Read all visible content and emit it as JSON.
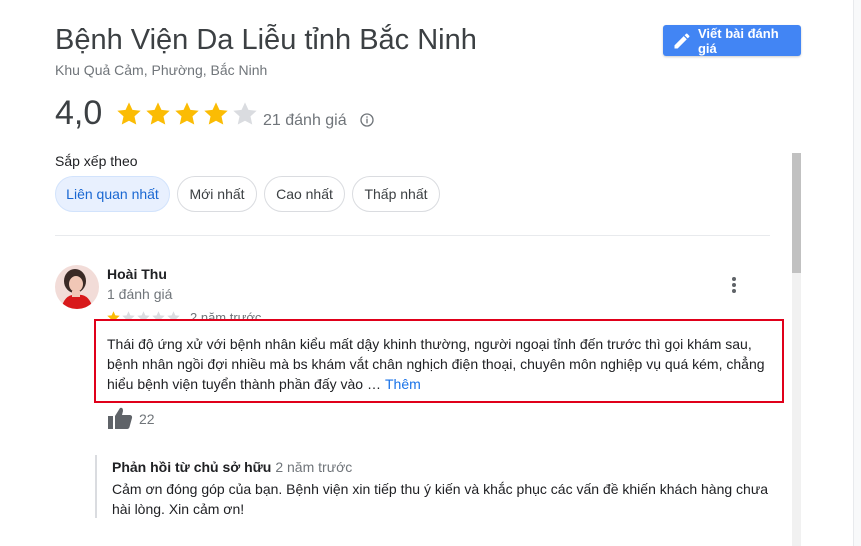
{
  "place": {
    "title": "Bệnh Viện Da Liễu tỉnh Bắc Ninh",
    "address": "Khu Quả Cảm, Phường, Bắc Ninh",
    "write_review_label": "Viết bài đánh giá"
  },
  "rating": {
    "value": "4,0",
    "stars": 4,
    "count_label": "21 đánh giá"
  },
  "sort": {
    "label": "Sắp xếp theo",
    "options": [
      "Liên quan nhất",
      "Mới nhất",
      "Cao nhất",
      "Thấp nhất"
    ],
    "selected": "Liên quan nhất"
  },
  "review": {
    "author": "Hoài Thu",
    "author_meta": "1 đánh giá",
    "stars": 1,
    "time": "2 năm trước",
    "text": "Thái độ ứng xử với bệnh nhân kiểu mất dậy khinh thường, người ngoại tỉnh đến trước thì gọi khám sau, bệnh nhân ngồi đợi nhiều mà bs khám vắt chân nghịch điện thoại, chuyên môn nghiệp vụ quá kém, chẳng hiểu bệnh viện tuyển thành phần đấy vào …",
    "more_label": "Thêm",
    "likes": "22"
  },
  "owner_reply": {
    "title": "Phản hồi từ chủ sở hữu",
    "time": "2 năm trước",
    "text": "Cảm ơn đóng góp của bạn. Bệnh viện xin tiếp thu ý kiến và khắc phục các vấn đề khiến khách hàng chưa hài lòng. Xin cảm ơn!"
  },
  "colors": {
    "accent": "#4285f4",
    "star": "#fbbc04",
    "highlight": "#e0001a"
  }
}
